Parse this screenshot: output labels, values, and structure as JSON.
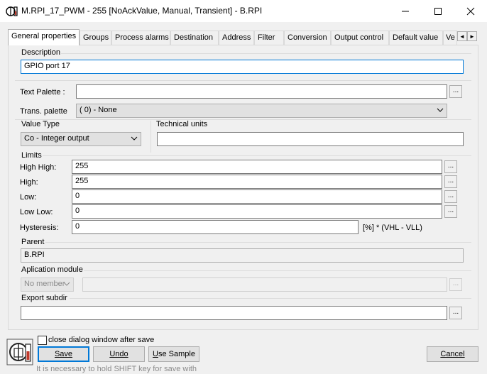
{
  "window": {
    "title": "M.RPI_17_PWM - 255 [NoAckValue, Manual, Transient] - B.RPI",
    "controls": [
      "minimize",
      "maximize",
      "close"
    ]
  },
  "tabs": [
    {
      "label": "General properties",
      "active": true
    },
    {
      "label": "Groups"
    },
    {
      "label": "Process alarms"
    },
    {
      "label": "Destination"
    },
    {
      "label": "Address"
    },
    {
      "label": "Filter"
    },
    {
      "label": "Conversion"
    },
    {
      "label": "Output control"
    },
    {
      "label": "Default value"
    },
    {
      "label": "Ve"
    }
  ],
  "tab_scroll": {
    "left": "◄",
    "right": "►"
  },
  "description": {
    "label": "Description",
    "value": "GPIO port 17"
  },
  "text_palette": {
    "label": "Text Palette :",
    "value": "",
    "browse": "..."
  },
  "trans_palette": {
    "label": "Trans. palette",
    "value": "( 0) - None"
  },
  "value_type": {
    "label": "Value Type",
    "value": "Co - Integer output"
  },
  "technical_units": {
    "label": "Technical units",
    "value": ""
  },
  "limits": {
    "label": "Limits",
    "high_high": {
      "label": "High High:",
      "value": "255",
      "browse": "..."
    },
    "high": {
      "label": "High:",
      "value": "255",
      "browse": "..."
    },
    "low": {
      "label": "Low:",
      "value": "0",
      "browse": "..."
    },
    "low_low": {
      "label": "Low Low:",
      "value": "0",
      "browse": "..."
    },
    "hysteresis": {
      "label": "Hysteresis:",
      "value": "0",
      "unit": "[%] * (VHL - VLL)"
    }
  },
  "parent": {
    "label": "Parent",
    "value": "B.RPI"
  },
  "application_module": {
    "label": "Aplication module",
    "combo": "No member",
    "value": "",
    "browse": "..."
  },
  "export_subdir": {
    "label": "Export subdir",
    "value": "",
    "browse": "..."
  },
  "footer": {
    "close_after_save": "close dialog window after save",
    "save": "Save",
    "undo": "Undo",
    "use_sample_u": "U",
    "use_sample_rest": "se Sample",
    "cancel": "Cancel",
    "hint": "It is necessary to hold SHIFT key for save with"
  },
  "colors": {
    "focus": "#0078d7",
    "icon_red": "#c0392b"
  }
}
